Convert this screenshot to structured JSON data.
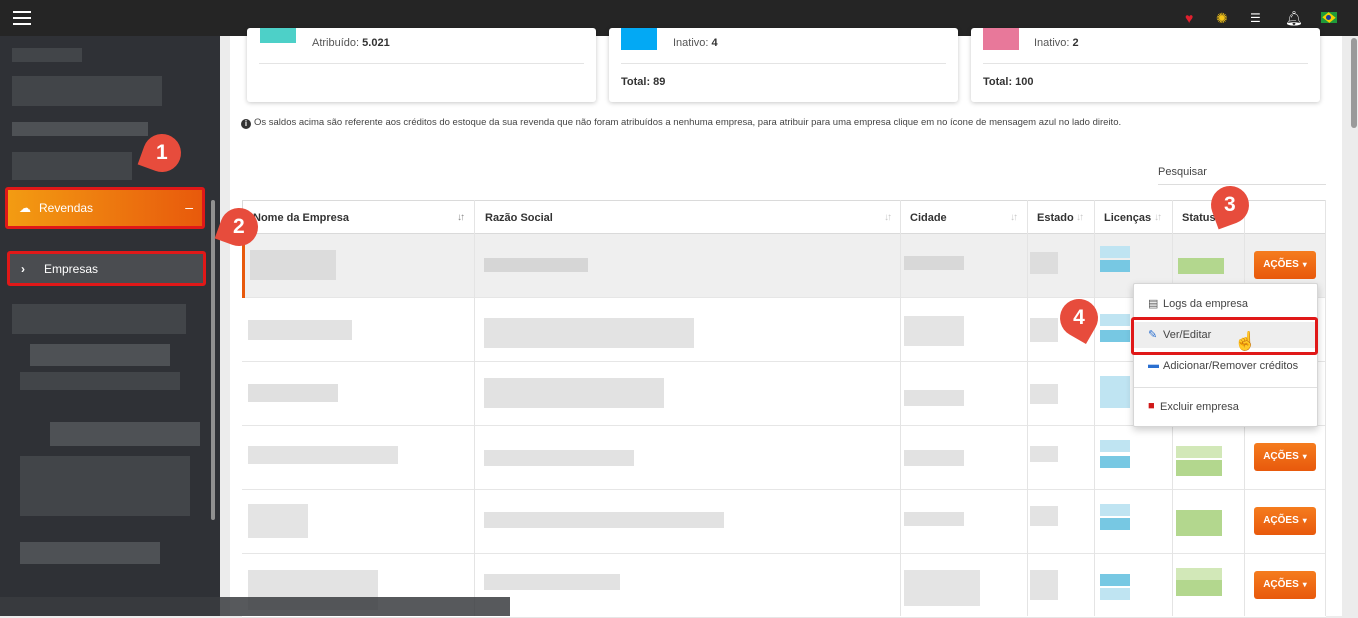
{
  "topbar": {
    "menu_icon": "hamburger-menu-icon",
    "icons": [
      "heart-icon",
      "lightbulb-icon",
      "list-icon",
      "bell-icon",
      "brazil-flag-icon"
    ],
    "heart_color": "#e0202e",
    "bulb_color": "#f5c518"
  },
  "sidebar": {
    "revendas_label": "Revendas",
    "revendas_toggle": "–",
    "empresas_label": "Empresas",
    "empresas_chevron": "›",
    "accent": "#e8590c"
  },
  "cards": [
    {
      "label": "Atribuído:",
      "value": "5.021",
      "color": "#4dd0c8",
      "total": ""
    },
    {
      "label": "Inativo:",
      "value": "4",
      "color": "#03a9f4",
      "total": "Total: 89"
    },
    {
      "label": "Inativo:",
      "value": "2",
      "color": "#e8789a",
      "total": "Total: 100"
    }
  ],
  "info_text": "Os saldos acima são referente aos créditos do estoque da sua revenda que não foram atribuídos a nenhuma empresa, para atribuir para uma empresa clique em no ícone de mensagem azul no lado direito.",
  "search_label": "Pesquisar",
  "table": {
    "headers": [
      "Nome da Empresa",
      "Razão Social",
      "Cidade",
      "Estado",
      "Licenças",
      "Status"
    ],
    "actions_label": "AÇÕES",
    "actions_caret": "▾"
  },
  "dropdown": {
    "items": [
      {
        "label": "Logs da empresa",
        "icon": "log-icon"
      },
      {
        "label": "Ver/Editar",
        "icon": "pencil-icon"
      },
      {
        "label": "Adicionar/Remover créditos",
        "icon": "message-icon"
      },
      {
        "label": "Excluir empresa",
        "icon": "trash-icon"
      }
    ]
  },
  "annotations": [
    "1",
    "2",
    "3",
    "4"
  ]
}
